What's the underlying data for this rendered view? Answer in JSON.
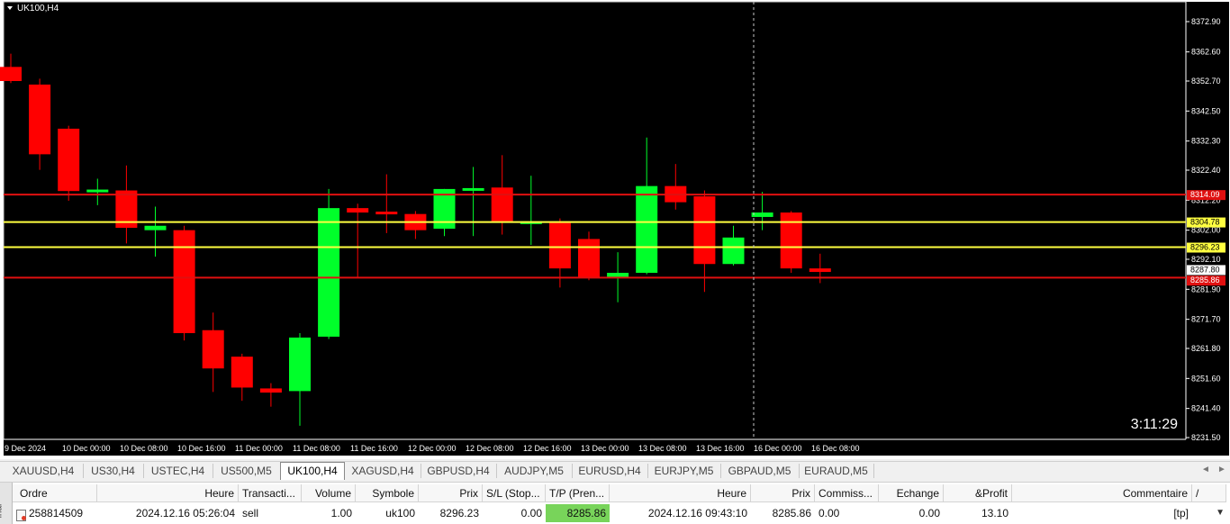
{
  "chart": {
    "symbol_label": "UK100,H4",
    "timer": "3:11:29",
    "colors": {
      "background": "#000000",
      "bull": "#00ff2a",
      "bear": "#ff0000",
      "grid_text": "#ffffff",
      "resistance": "#e01010",
      "support": "#ffff40",
      "crosshair": "#c8c8c8"
    },
    "price_labels": [
      "8372.90",
      "8362.60",
      "8352.70",
      "8342.50",
      "8332.30",
      "8322.40",
      "8312.20",
      "8302.00",
      "8292.10",
      "8281.90",
      "8271.70",
      "8261.80",
      "8251.60",
      "8241.40",
      "8231.50"
    ],
    "time_labels": [
      "9 Dec 2024",
      "10 Dec 00:00",
      "10 Dec 08:00",
      "10 Dec 16:00",
      "11 Dec 00:00",
      "11 Dec 08:00",
      "11 Dec 16:00",
      "12 Dec 00:00",
      "12 Dec 08:00",
      "12 Dec 16:00",
      "13 Dec 00:00",
      "13 Dec 08:00",
      "13 Dec 16:00",
      "16 Dec 00:00",
      "16 Dec 08:00"
    ],
    "level_labels": [
      {
        "text": "8314.09",
        "type": "resistance"
      },
      {
        "text": "8304.78",
        "type": "support"
      },
      {
        "text": "8296.23",
        "type": "support"
      },
      {
        "text": "8287.80",
        "type": "current"
      },
      {
        "text": "8285.86",
        "type": "resistance"
      }
    ]
  },
  "chart_data": {
    "type": "candlestick",
    "ylim": [
      8231.5,
      8372.9
    ],
    "candles": [
      {
        "o": 8357.5,
        "h": 8362.0,
        "l": 8352.0,
        "c": 8352.7
      },
      {
        "o": 8351.5,
        "h": 8353.5,
        "l": 8322.5,
        "c": 8327.8
      },
      {
        "o": 8336.5,
        "h": 8337.5,
        "l": 8312.0,
        "c": 8315.3
      },
      {
        "o": 8315.2,
        "h": 8319.5,
        "l": 8310.5,
        "c": 8315.8
      },
      {
        "o": 8315.5,
        "h": 8324.0,
        "l": 8297.5,
        "c": 8302.8
      },
      {
        "o": 8302.0,
        "h": 8310.0,
        "l": 8293.0,
        "c": 8303.5
      },
      {
        "o": 8302.0,
        "h": 8303.5,
        "l": 8264.5,
        "c": 8267.0
      },
      {
        "o": 8268.0,
        "h": 8274.0,
        "l": 8247.0,
        "c": 8255.0
      },
      {
        "o": 8259.0,
        "h": 8260.0,
        "l": 8244.0,
        "c": 8248.5
      },
      {
        "o": 8248.2,
        "h": 8250.0,
        "l": 8242.0,
        "c": 8246.8
      },
      {
        "o": 8247.3,
        "h": 8267.0,
        "l": 8235.5,
        "c": 8265.5
      },
      {
        "o": 8265.8,
        "h": 8316.0,
        "l": 8265.0,
        "c": 8309.5
      },
      {
        "o": 8309.5,
        "h": 8311.0,
        "l": 8285.8,
        "c": 8308.0
      },
      {
        "o": 8308.3,
        "h": 8321.0,
        "l": 8301.0,
        "c": 8308.0
      },
      {
        "o": 8307.5,
        "h": 8308.5,
        "l": 8299.0,
        "c": 8302.0
      },
      {
        "o": 8302.5,
        "h": 8316.0,
        "l": 8300.0,
        "c": 8316.0
      },
      {
        "o": 8315.5,
        "h": 8323.5,
        "l": 8300.0,
        "c": 8316.3
      },
      {
        "o": 8316.5,
        "h": 8327.5,
        "l": 8300.5,
        "c": 8305.0
      },
      {
        "o": 8304.5,
        "h": 8320.5,
        "l": 8297.0,
        "c": 8305.0
      },
      {
        "o": 8305.0,
        "h": 8306.0,
        "l": 8282.5,
        "c": 8289.0
      },
      {
        "o": 8299.0,
        "h": 8301.5,
        "l": 8285.0,
        "c": 8286.0
      },
      {
        "o": 8286.0,
        "h": 8294.5,
        "l": 8277.5,
        "c": 8287.5
      },
      {
        "o": 8287.5,
        "h": 8333.5,
        "l": 8287.0,
        "c": 8317.0
      },
      {
        "o": 8317.0,
        "h": 8324.5,
        "l": 8309.0,
        "c": 8311.5
      },
      {
        "o": 8313.5,
        "h": 8315.5,
        "l": 8281.0,
        "c": 8290.5
      },
      {
        "o": 8290.5,
        "h": 8303.5,
        "l": 8290.0,
        "c": 8299.5
      },
      {
        "o": 8306.5,
        "h": 8315.0,
        "l": 8302.0,
        "c": 8308.0
      },
      {
        "o": 8308.0,
        "h": 8308.5,
        "l": 8287.5,
        "c": 8289.0
      },
      {
        "o": 8289.0,
        "h": 8294.0,
        "l": 8284.0,
        "c": 8287.8
      }
    ],
    "levels": [
      {
        "price": 8314.09,
        "type": "resistance"
      },
      {
        "price": 8304.78,
        "type": "support"
      },
      {
        "price": 8296.23,
        "type": "support"
      },
      {
        "price": 8285.86,
        "type": "resistance"
      }
    ]
  },
  "tabs": {
    "items": [
      "XAUUSD,H4",
      "US30,H4",
      "USTEC,H4",
      "US500,M5",
      "UK100,H4",
      "XAGUSD,H4",
      "GBPUSD,H4",
      "AUDJPY,M5",
      "EURUSD,H4",
      "EURJPY,M5",
      "GBPAUD,M5",
      "EURAUD,M5"
    ],
    "active_index": 4
  },
  "terminal": {
    "side_label": "inal",
    "headers": [
      "Ordre",
      "Heure",
      "Transacti...",
      "Volume",
      "Symbole",
      "Prix",
      "S/L (Stop...",
      "T/P (Pren...",
      "Heure",
      "Prix",
      "Commiss...",
      "Echange",
      "&Profit",
      "Commentaire"
    ],
    "sort_indicator": "/",
    "row": [
      "258814509",
      "2024.12.16 05:26:04",
      "sell",
      "1.00",
      "uk100",
      "8296.23",
      "0.00",
      "8285.86",
      "2024.12.16 09:43:10",
      "8285.86",
      "0.00",
      "0.00",
      "13.10",
      "[tp]"
    ]
  }
}
